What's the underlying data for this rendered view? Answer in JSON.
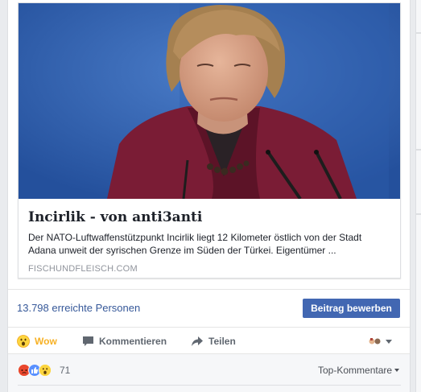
{
  "link": {
    "image_alt": "Photo of a woman in a burgundy jacket in front of microphones",
    "title": "Incirlik - von anti3anti",
    "description": "Der NATO-Luftwaffenstützpunkt Incirlik liegt 12 Kilometer östlich von der Stadt Adana unweit der syrischen Grenze im Süden der Türkei. Eigentümer ...",
    "domain": "FISCHUNDFLEISCH.COM"
  },
  "insights": {
    "reach_text": "13.798 erreichte Personen",
    "boost_label": "Beitrag bewerben"
  },
  "actions": {
    "wow_label": "Wow",
    "comment_label": "Kommentieren",
    "share_label": "Teilen"
  },
  "reactions": {
    "count": "71",
    "types": [
      "angry",
      "like",
      "wow"
    ],
    "sort_label": "Top-Kommentare"
  },
  "colors": {
    "link_blue": "#365899",
    "button_blue": "#4267b2",
    "wow_yellow": "#f7b125"
  }
}
